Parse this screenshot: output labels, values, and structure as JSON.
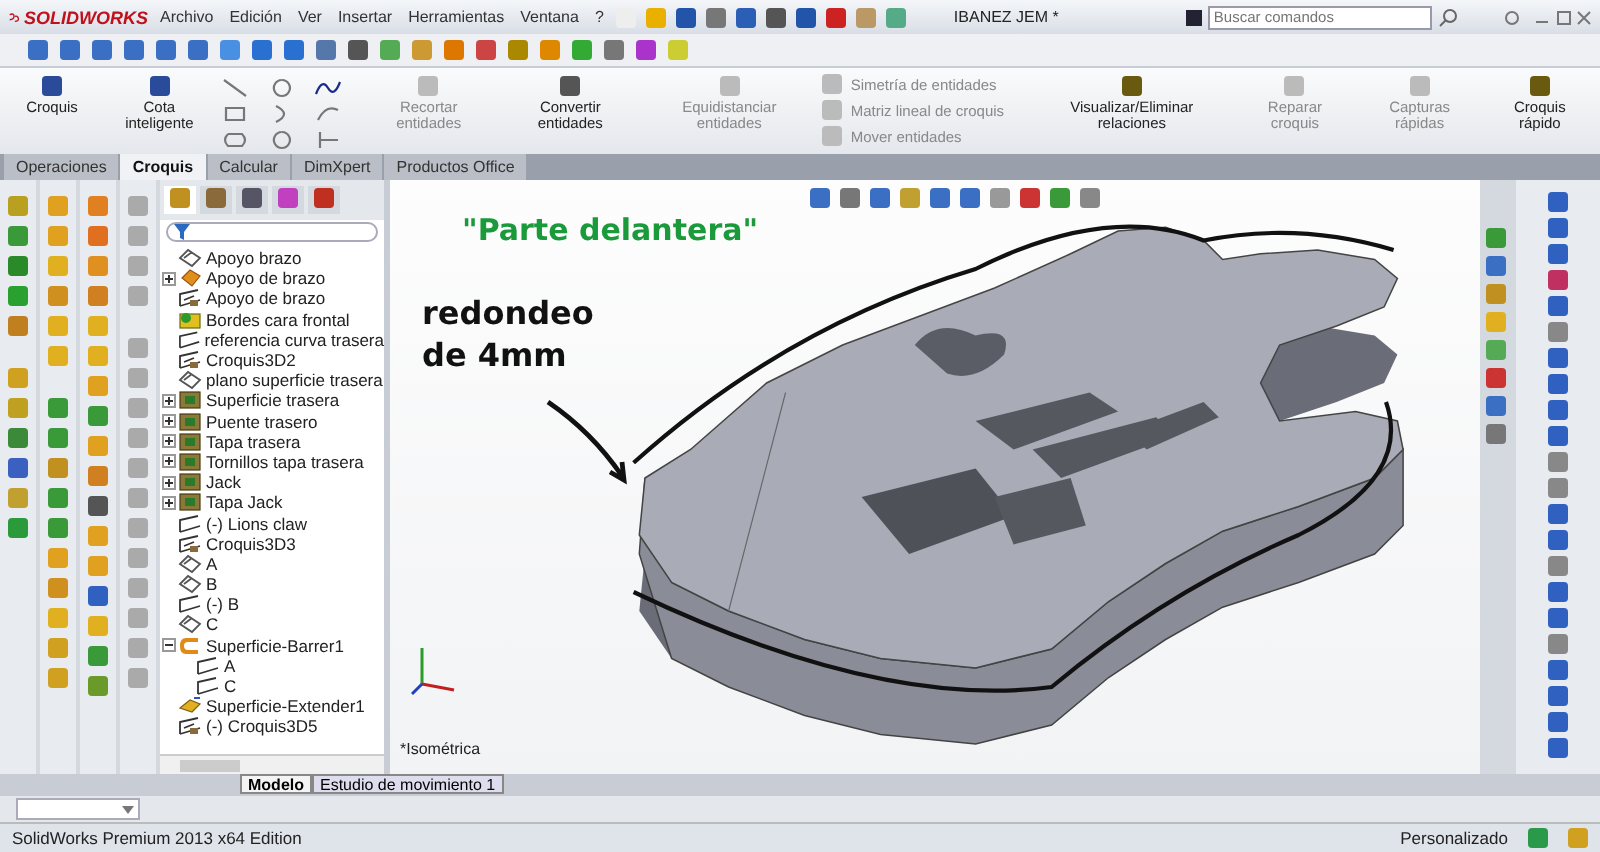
{
  "title_bar": {
    "logo": "SOLIDWORKS",
    "menu": [
      "Archivo",
      "Edición",
      "Ver",
      "Insertar",
      "Herramientas",
      "Ventana",
      "?"
    ],
    "document_title": "IBANEZ JEM *",
    "search": {
      "placeholder": "Buscar comandos"
    }
  },
  "ribbon": {
    "large_tools": [
      {
        "label": "Croquis",
        "disabled": false
      },
      {
        "label": "Cota inteligente",
        "disabled": false
      }
    ],
    "mid_tools": [
      {
        "label": "Recortar entidades",
        "disabled": true
      },
      {
        "label": "Convertir entidades",
        "disabled": false
      },
      {
        "label": "Equidistanciar entidades",
        "disabled": true
      }
    ],
    "list_tools": [
      {
        "label": "Simetría de entidades",
        "disabled": true
      },
      {
        "label": "Matriz lineal de croquis",
        "disabled": true
      },
      {
        "label": "Mover entidades",
        "disabled": true
      }
    ],
    "end_tools": [
      {
        "label": "Visualizar/Eliminar relaciones",
        "disabled": false
      },
      {
        "label": "Reparar croquis",
        "disabled": true
      },
      {
        "label": "Capturas rápidas",
        "disabled": true
      },
      {
        "label": "Croquis rápido",
        "disabled": false
      }
    ]
  },
  "tabs": [
    {
      "label": "Operaciones",
      "selected": false
    },
    {
      "label": "Croquis",
      "selected": true
    },
    {
      "label": "Calcular",
      "selected": false
    },
    {
      "label": "DimXpert",
      "selected": false
    },
    {
      "label": "Productos Office",
      "selected": false
    }
  ],
  "panel_tabs": [
    {
      "selected": true
    },
    {
      "selected": false
    },
    {
      "selected": false
    },
    {
      "selected": false
    },
    {
      "selected": false
    }
  ],
  "tree": {
    "items": [
      {
        "label": "Apoyo brazo",
        "kind": "plane"
      },
      {
        "label": "Apoyo de brazo",
        "kind": "feature",
        "expanded": false
      },
      {
        "label": "Apoyo de brazo",
        "kind": "sketch3d"
      },
      {
        "label": "Bordes cara frontal",
        "kind": "surface"
      },
      {
        "label": "referencia curva trasera",
        "kind": "sketch"
      },
      {
        "label": "Croquis3D2",
        "kind": "sketch3d"
      },
      {
        "label": "plano superficie trasera",
        "kind": "plane"
      },
      {
        "label": "Superficie trasera",
        "kind": "body",
        "expanded": false
      },
      {
        "label": "Puente trasero",
        "kind": "body",
        "expanded": false
      },
      {
        "label": "Tapa trasera",
        "kind": "body",
        "expanded": false
      },
      {
        "label": "Tornillos tapa trasera",
        "kind": "body",
        "expanded": false
      },
      {
        "label": "Jack",
        "kind": "body",
        "expanded": false
      },
      {
        "label": "Tapa Jack",
        "kind": "body",
        "expanded": false
      },
      {
        "label": "(-) Lions claw",
        "kind": "sketch"
      },
      {
        "label": "Croquis3D3",
        "kind": "sketch3d"
      },
      {
        "label": "A",
        "kind": "plane"
      },
      {
        "label": "B",
        "kind": "plane"
      },
      {
        "label": "(-) B",
        "kind": "sketch"
      },
      {
        "label": "C",
        "kind": "plane"
      },
      {
        "label": "Superficie-Barrer1",
        "kind": "sweep",
        "expanded": true,
        "children": [
          {
            "label": "A",
            "kind": "sketch"
          },
          {
            "label": "C",
            "kind": "sketch"
          }
        ]
      },
      {
        "label": "Superficie-Extender1",
        "kind": "extend"
      },
      {
        "label": "(-) Croquis3D5",
        "kind": "sketch3d"
      }
    ]
  },
  "bottom_tabs": [
    {
      "label": "Modelo",
      "selected": true
    },
    {
      "label": "Estudio de movimiento 1",
      "selected": false
    }
  ],
  "viewport": {
    "annotations": [
      "\"Parte delantera\"",
      "redondeo de 4mm"
    ],
    "view_label": "*Isométrica"
  },
  "status_bar": {
    "product": "SolidWorks Premium 2013 x64 Edition",
    "units": "Personalizado"
  }
}
